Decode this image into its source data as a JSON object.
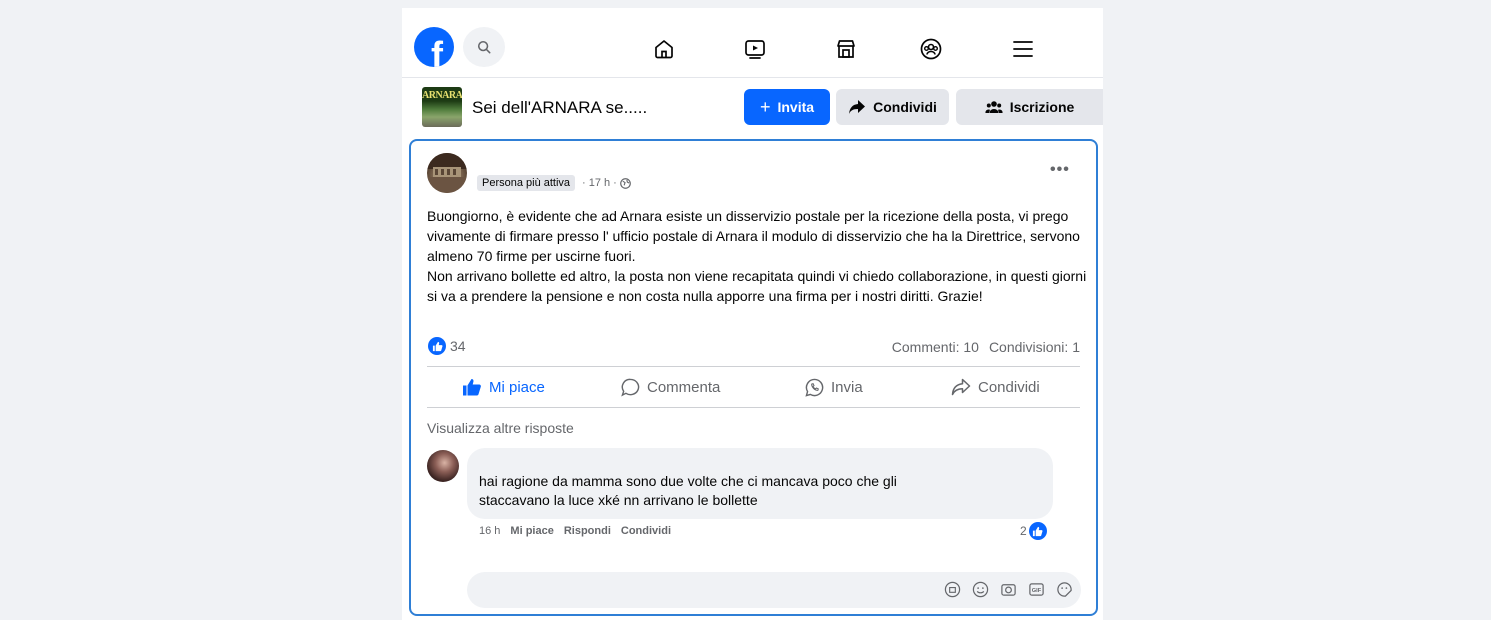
{
  "nav": {
    "logo_letter": "f",
    "icons": [
      "search-icon",
      "home-icon",
      "video-icon",
      "marketplace-icon",
      "groups-icon",
      "menu-icon"
    ]
  },
  "group": {
    "thumb_text": "ARNARA",
    "title": "Sei dell'ARNARA se.....",
    "invite_label": "Invita",
    "share_label": "Condividi",
    "subscribe_label": "Iscrizione"
  },
  "post": {
    "badge": "Persona più attiva",
    "time": "· 17 h ·",
    "paragraphs": [
      "Buongiorno, è evidente che ad Arnara esiste un disservizio postale per la ricezione della posta, vi prego vivamente di firmare presso l' ufficio postale di Arnara il modulo di disservizio che ha la Direttrice, servono almeno 70 firme per uscirne fuori.",
      "Non arrivano bollette ed altro, la posta non viene recapitata quindi vi chiedo collaborazione, in questi giorni si va a prendere la pensione e non costa nulla apporre una firma per i nostri diritti. Grazie!"
    ],
    "like_count": "34",
    "comments_label": "Commenti: 10",
    "shares_label": "Condivisioni: 1"
  },
  "actions": {
    "like": "Mi piace",
    "comment": "Commenta",
    "send": "Invia",
    "share": "Condividi"
  },
  "comments": {
    "view_more": "Visualizza altre risposte",
    "items": [
      {
        "text": "hai ragione da mamma sono due volte che ci mancava poco che gli staccavano la luce xké nn arrivano le bollette",
        "time": "16 h",
        "like": "Mi piace",
        "reply": "Rispondi",
        "share": "Condividi",
        "likes": "2"
      }
    ]
  },
  "colors": {
    "accent": "#0866ff",
    "card_border": "#2f7fd6",
    "secondary_text": "#65676b",
    "bubble": "#f0f2f5"
  }
}
